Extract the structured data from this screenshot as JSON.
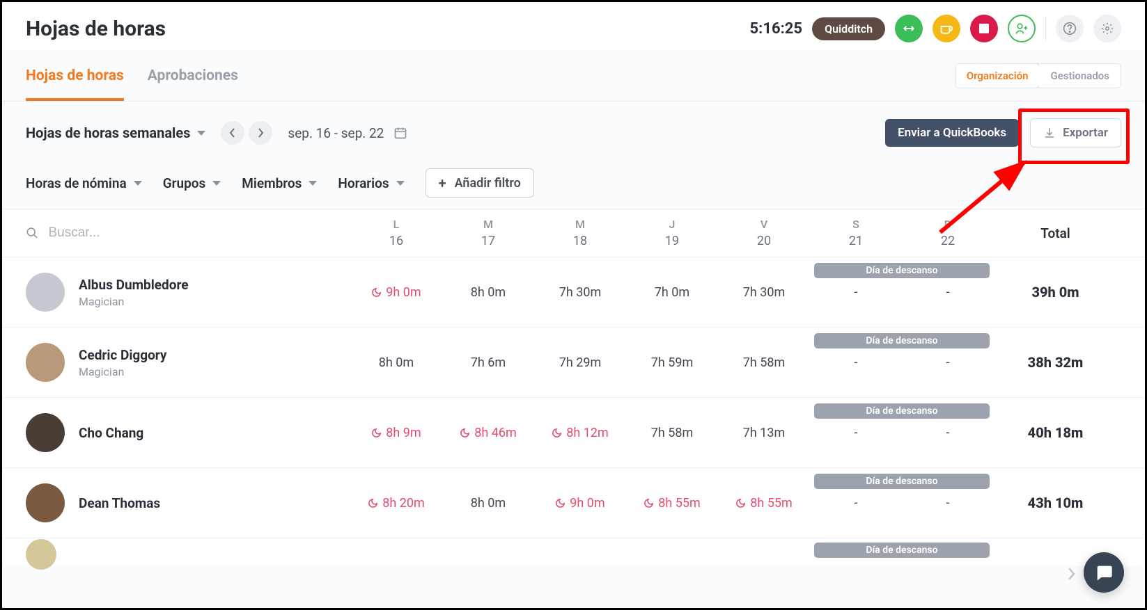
{
  "header": {
    "title": "Hojas de horas",
    "timer": "5:16:25",
    "project_badge": "Quidditch"
  },
  "tabs": {
    "items": [
      {
        "label": "Hojas de horas",
        "active": true
      },
      {
        "label": "Aprobaciones",
        "active": false
      }
    ],
    "segmented": [
      {
        "label": "Organización",
        "active": true
      },
      {
        "label": "Gestionados",
        "active": false
      }
    ]
  },
  "toolbar": {
    "period_label": "Hojas de horas semanales",
    "date_range": "sep. 16 - sep. 22",
    "quickbooks_btn": "Enviar a QuickBooks",
    "export_btn": "Exportar"
  },
  "filters": {
    "items": [
      "Horas de nómina",
      "Grupos",
      "Miembros",
      "Horarios"
    ],
    "add_filter_label": "Añadir filtro"
  },
  "table": {
    "search_placeholder": "Buscar...",
    "total_label": "Total",
    "rest_day_label": "Día de descanso",
    "days": [
      {
        "letter": "L",
        "num": "16"
      },
      {
        "letter": "M",
        "num": "17"
      },
      {
        "letter": "M",
        "num": "18"
      },
      {
        "letter": "J",
        "num": "19"
      },
      {
        "letter": "V",
        "num": "20"
      },
      {
        "letter": "S",
        "num": "21"
      },
      {
        "letter": "D",
        "num": "22"
      }
    ],
    "rows": [
      {
        "name": "Albus Dumbledore",
        "role": "Magician",
        "avatar_color": "#c6c9cf",
        "cells": [
          {
            "val": "9h 0m",
            "red": true
          },
          {
            "val": "8h 0m",
            "red": false
          },
          {
            "val": "7h 30m",
            "red": false
          },
          {
            "val": "7h 0m",
            "red": false
          },
          {
            "val": "7h 30m",
            "red": false
          },
          {
            "val": "-",
            "red": false
          },
          {
            "val": "-",
            "red": false
          }
        ],
        "total": "39h 0m"
      },
      {
        "name": "Cedric Diggory",
        "role": "Magician",
        "avatar_color": "#b89a7a",
        "cells": [
          {
            "val": "8h 0m",
            "red": false
          },
          {
            "val": "7h 6m",
            "red": false
          },
          {
            "val": "7h 29m",
            "red": false
          },
          {
            "val": "7h 59m",
            "red": false
          },
          {
            "val": "7h 58m",
            "red": false
          },
          {
            "val": "-",
            "red": false
          },
          {
            "val": "-",
            "red": false
          }
        ],
        "total": "38h 32m"
      },
      {
        "name": "Cho Chang",
        "role": "",
        "avatar_color": "#4a3d35",
        "cells": [
          {
            "val": "8h 9m",
            "red": true
          },
          {
            "val": "8h 46m",
            "red": true
          },
          {
            "val": "8h 12m",
            "red": true
          },
          {
            "val": "7h 58m",
            "red": false
          },
          {
            "val": "7h 13m",
            "red": false
          },
          {
            "val": "-",
            "red": false
          },
          {
            "val": "-",
            "red": false
          }
        ],
        "total": "40h 18m"
      },
      {
        "name": "Dean Thomas",
        "role": "",
        "avatar_color": "#7c5a40",
        "cells": [
          {
            "val": "8h 20m",
            "red": true
          },
          {
            "val": "8h 0m",
            "red": false
          },
          {
            "val": "9h 0m",
            "red": true
          },
          {
            "val": "8h 55m",
            "red": true
          },
          {
            "val": "8h 55m",
            "red": true
          },
          {
            "val": "-",
            "red": false
          },
          {
            "val": "-",
            "red": false
          }
        ],
        "total": "43h 10m"
      }
    ]
  }
}
